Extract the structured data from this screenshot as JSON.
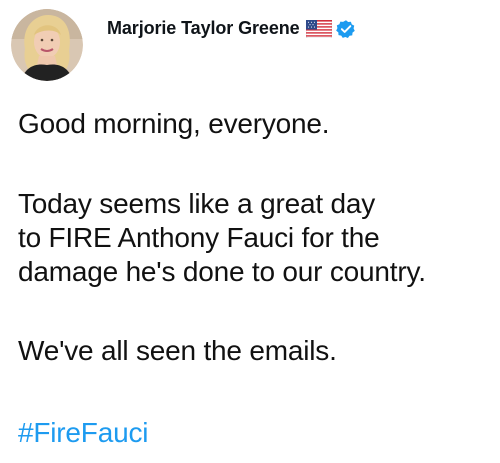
{
  "author": {
    "display_name": "Marjorie Taylor Greene",
    "avatar_icon": "avatar-photo",
    "flag_icon": "us-flag-icon",
    "verified_icon": "verified-badge-icon"
  },
  "tweet": {
    "paragraphs": [
      "Good morning, everyone.",
      "Today seems like a great day\nto FIRE Anthony Fauci for the\ndamage he's done to our country.",
      "We've all seen the emails."
    ],
    "hashtag": "#FireFauci"
  },
  "colors": {
    "text": "#111111",
    "link": "#1d9bf0",
    "verified": "#1d9bf0",
    "background": "#ffffff"
  }
}
